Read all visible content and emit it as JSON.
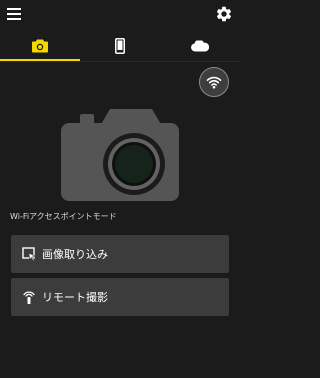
{
  "header": {
    "menu_icon": "hamburger-menu-icon",
    "settings_icon": "gear-icon"
  },
  "tabs": [
    {
      "icon": "camera-icon",
      "active": true
    },
    {
      "icon": "smartphone-icon",
      "active": false
    },
    {
      "icon": "cloud-icon",
      "active": false
    }
  ],
  "wifi_button": {
    "icon": "wifi-icon"
  },
  "main": {
    "illustration": "camera-illustration",
    "mode_label": "Wi-Fiアクセスポイントモード"
  },
  "actions": {
    "import": {
      "label": "画像取り込み",
      "icon": "image-import-icon"
    },
    "remote": {
      "label": "リモート撮影",
      "icon": "remote-shooting-icon"
    }
  },
  "colors": {
    "background": "#1b1b1b",
    "accent": "#f5d800",
    "button_bg": "#3c3c3c",
    "illustration": "#555555"
  }
}
